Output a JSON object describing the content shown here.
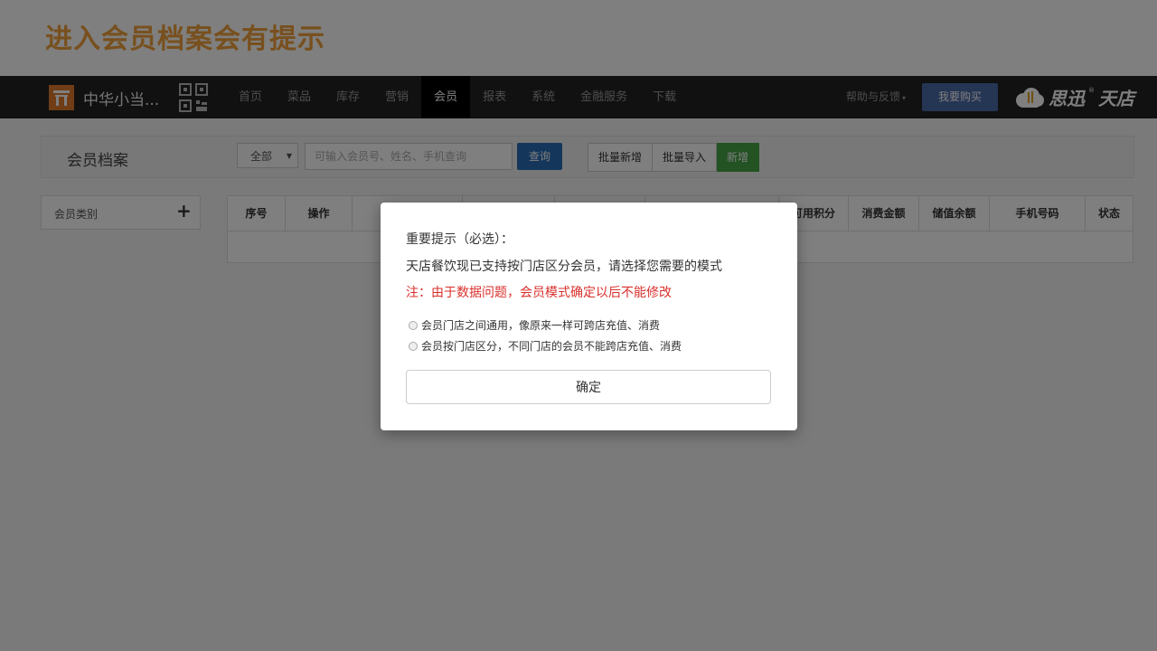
{
  "slide_title": "进入会员档案会有提示",
  "navbar": {
    "shop_name": "中华小当...",
    "items": [
      "首页",
      "菜品",
      "库存",
      "营销",
      "会员",
      "报表",
      "系统",
      "金融服务",
      "下载"
    ],
    "active_item": "会员",
    "help_label": "帮助与反馈",
    "buy_label": "我要购买",
    "brand_name": "思迅",
    "brand_product": "天店",
    "colors": {
      "bg": "#222222",
      "buy": "#4a6aa8",
      "logo": "#e07a2c"
    }
  },
  "toolbar": {
    "title": "会员档案",
    "filter_value": "全部",
    "search_placeholder": "可输入会员号、姓名、手机查询",
    "query_label": "查询",
    "batch_add_label": "批量新增",
    "batch_import_label": "批量导入",
    "new_label": "新增"
  },
  "sidebar": {
    "category_label": "会员类别",
    "add_symbol": "+"
  },
  "table": {
    "headers": [
      "序号",
      "操作",
      "",
      "",
      "",
      "",
      "可用积分",
      "消费金额",
      "储值余额",
      "手机号码",
      "状态"
    ]
  },
  "dialog": {
    "heading": "重要提示（必选）：",
    "description": "天店餐饮现已支持按门店区分会员，请选择您需要的模式",
    "warning": "注：由于数据问题，会员模式确定以后不能修改",
    "options": [
      "会员门店之间通用，像原来一样可跨店充值、消费",
      "会员按门店区分，不同门店的会员不能跨店充值、消费"
    ],
    "confirm_label": "确定",
    "warning_color": "#d9302c"
  }
}
